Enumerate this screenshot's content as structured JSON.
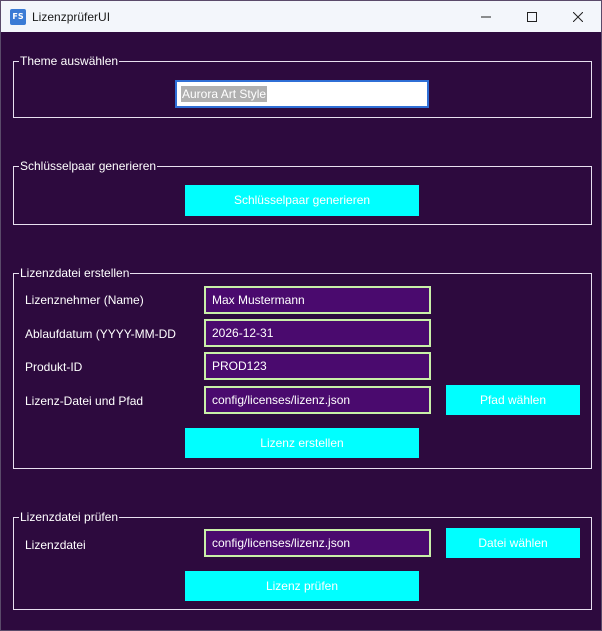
{
  "window": {
    "title": "LizenzprüferUI",
    "icon_text": "FS"
  },
  "theme_group": {
    "legend": "Theme auswählen",
    "selected_theme": "Aurora Art Style"
  },
  "keypair_group": {
    "legend": "Schlüsselpaar generieren",
    "generate_button": "Schlüsselpaar generieren"
  },
  "create_group": {
    "legend": "Lizenzdatei erstellen",
    "fields": [
      {
        "label": "Lizenznehmer (Name)",
        "value": "Max Mustermann"
      },
      {
        "label": "Ablaufdatum (YYYY-MM-DD",
        "value": "2026-12-31"
      },
      {
        "label": "Produkt-ID",
        "value": "PROD123"
      },
      {
        "label": "Lizenz-Datei und Pfad",
        "value": "config/licenses/lizenz.json"
      }
    ],
    "choose_path_button": "Pfad wählen",
    "create_button": "Lizenz erstellen"
  },
  "check_group": {
    "legend": "Lizenzdatei prüfen",
    "file_label": "Lizenzdatei",
    "file_value": "config/licenses/lizenz.json",
    "choose_file_button": "Datei wählen",
    "check_button": "Lizenz prüfen"
  },
  "colors": {
    "background": "#2d0a3e",
    "input_background": "#4a0a6e",
    "input_border": "#c9f0a8",
    "button": "#00ffff",
    "group_border": "#e8e0f0"
  }
}
